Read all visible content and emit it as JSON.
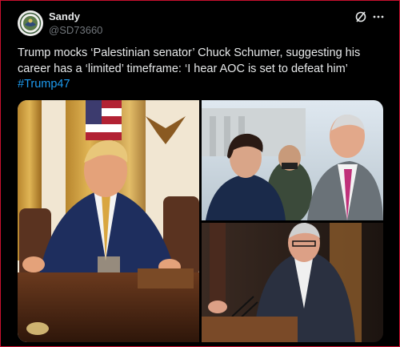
{
  "post": {
    "author_name": "Sandy",
    "author_handle": "@SD73660",
    "text": "Trump mocks ‘Palestinian senator’ Chuck Schumer, suggesting his career has a ‘limited’ timeframe: ‘I hear AOC is set to defeat him’",
    "hashtag": "#Trump47"
  },
  "icons": {
    "grok": "grok-icon",
    "more": "more-icon",
    "avatar": "avatar-emblem"
  },
  "colors": {
    "border": "#c8102e",
    "text": "#e7e9ea",
    "muted": "#71767b",
    "link": "#1d9bf0",
    "background": "#000000"
  }
}
